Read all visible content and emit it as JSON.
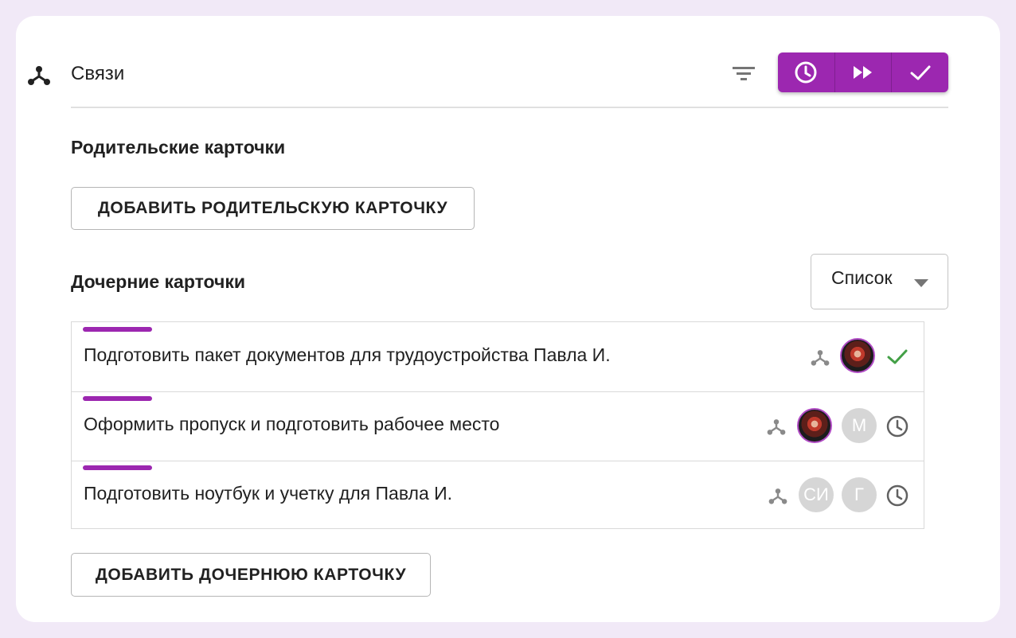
{
  "header": {
    "title": "Связи"
  },
  "toolbar": {
    "buttons": [
      {
        "name": "clock",
        "icon": "clock-icon"
      },
      {
        "name": "fast-forward",
        "icon": "fast-forward-icon"
      },
      {
        "name": "check",
        "icon": "check-icon"
      }
    ],
    "accent_color": "#9c27b0"
  },
  "parents": {
    "title": "Родительские карточки",
    "add_label": "ДОБАВИТЬ РОДИТЕЛЬСКУЮ КАРТОЧКУ"
  },
  "children": {
    "title": "Дочерние карточки",
    "view_value": "Список",
    "add_label": "ДОБАВИТЬ ДОЧЕРНЮЮ КАРТОЧКУ",
    "items": [
      {
        "text": "Подготовить пакет документов для трудоустройства Павла И.",
        "tag_color": "#9c27b0",
        "avatars": [
          "photo"
        ],
        "status": "done"
      },
      {
        "text": "Оформить пропуск и подготовить рабочее место",
        "tag_color": "#9c27b0",
        "avatars": [
          "photo",
          "М"
        ],
        "status": "pending"
      },
      {
        "text": "Подготовить ноутбук и учетку для Павла И.",
        "tag_color": "#9c27b0",
        "avatars": [
          "СИ",
          "Г"
        ],
        "status": "pending"
      }
    ]
  }
}
